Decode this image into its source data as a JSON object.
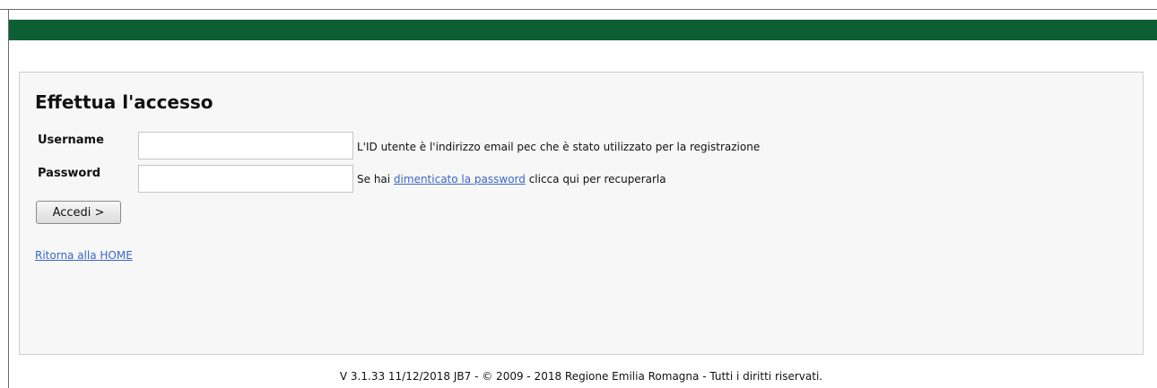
{
  "login": {
    "title": "Effettua l'accesso",
    "username_label": "Username",
    "username_value": "",
    "username_hint": "L'ID utente è l'indirizzo email pec che è stato utilizzato per la registrazione",
    "password_label": "Password",
    "password_value": "",
    "password_hint_prefix": "Se hai ",
    "password_hint_link": "dimenticato la password",
    "password_hint_suffix": " clicca qui per recuperarla",
    "submit_label": "Accedi >",
    "home_link": "Ritorna alla HOME"
  },
  "footer": {
    "text": "V 3.1.33 11/12/2018 JB7 - © 2009 - 2018 Regione Emilia Romagna - Tutti i diritti riservati."
  },
  "colors": {
    "header_bar": "#0d5e33",
    "link": "#3b66c5",
    "panel_background": "#f7f7f7"
  }
}
